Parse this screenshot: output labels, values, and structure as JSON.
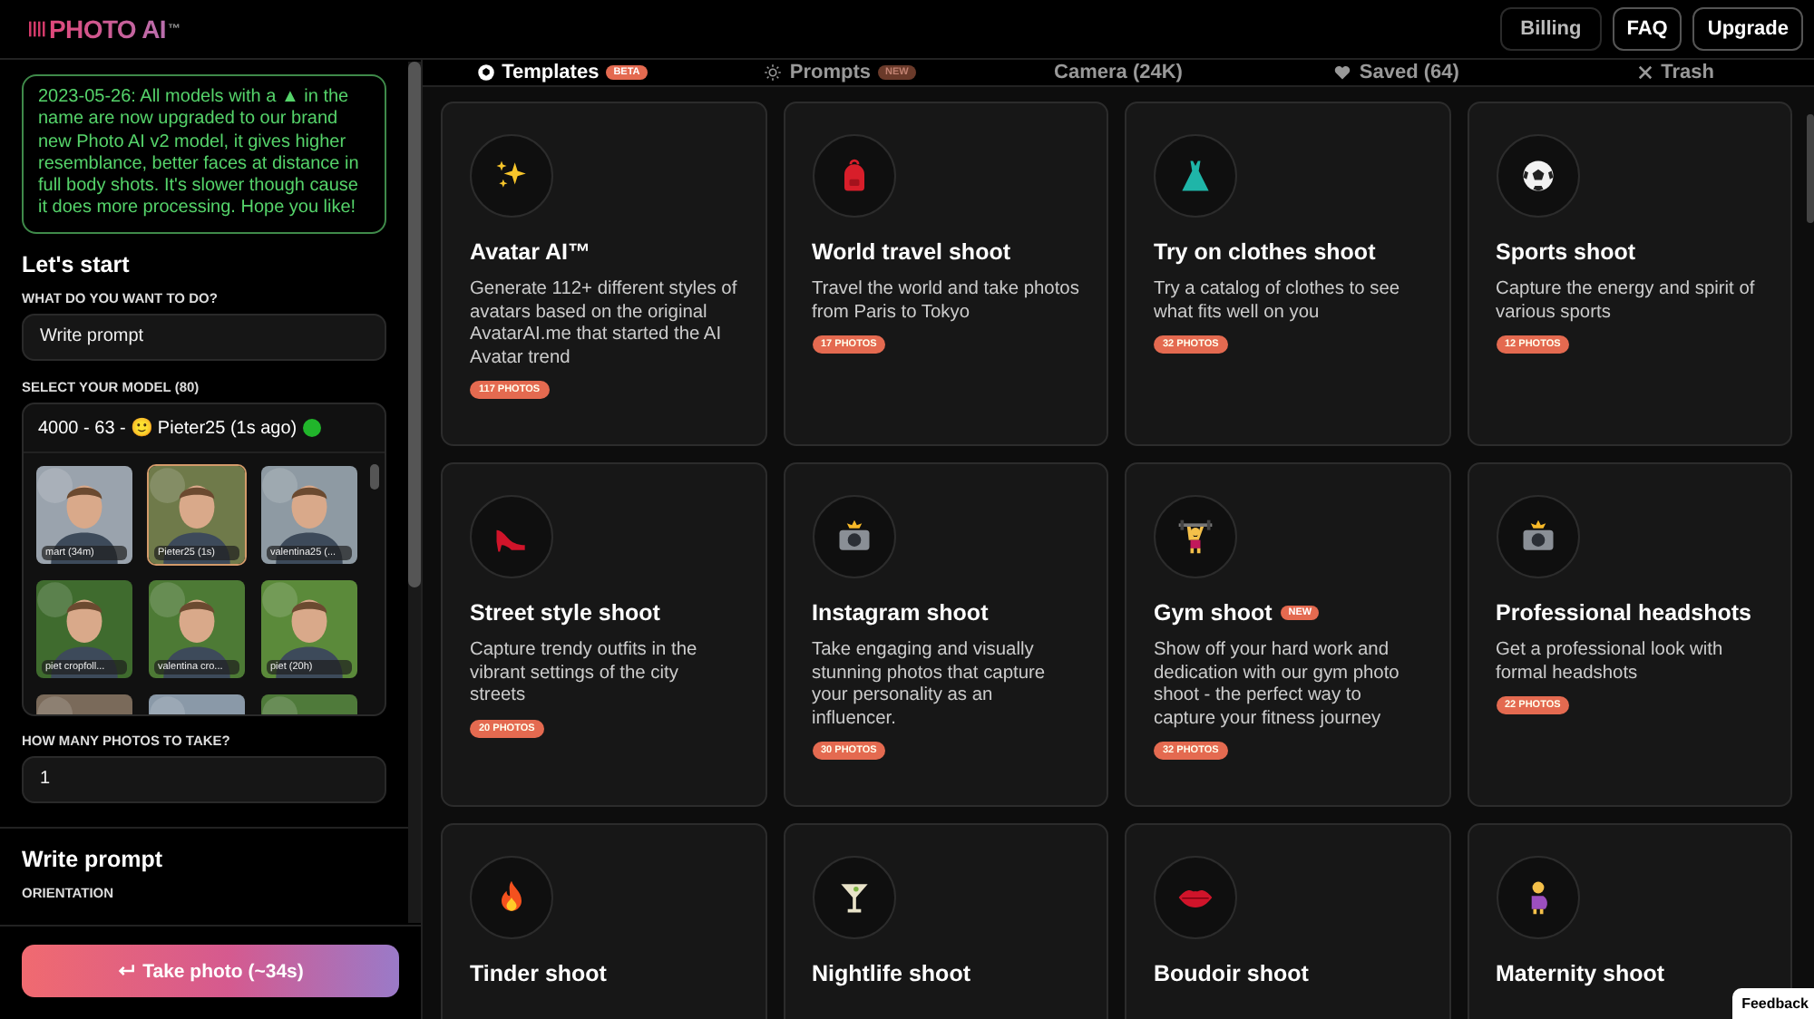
{
  "header": {
    "logo": "PHOTO AI",
    "logo_mark": "™",
    "buttons": [
      {
        "label": "Billing",
        "kind": "plain"
      },
      {
        "label": "FAQ",
        "kind": "outlined"
      },
      {
        "label": "Upgrade",
        "kind": "outlined"
      }
    ]
  },
  "sidebar": {
    "notice": "2023-05-26: All models with a ▲ in the name are now upgraded to our brand new Photo AI v2 model, it gives higher resemblance, better faces at distance in full body shots. It's slower though cause it does more processing. Hope you like!",
    "heading": "Let's start",
    "task": {
      "label": "WHAT DO YOU WANT TO DO?",
      "value": "Write prompt"
    },
    "model": {
      "label": "SELECT YOUR MODEL (80)",
      "value": "4000 - 63 - 🙂 Pieter25 (1s ago)",
      "online": true,
      "models": [
        {
          "caption": "mart (34m)",
          "selected": false
        },
        {
          "caption": "Pieter25 (1s)",
          "selected": true
        },
        {
          "caption": "valentina25 (...",
          "selected": false
        },
        {
          "caption": "piet cropfoll...",
          "selected": false
        },
        {
          "caption": "valentina cro...",
          "selected": false
        },
        {
          "caption": "piet (20h)",
          "selected": false
        },
        {
          "selected": false
        },
        {
          "selected": false
        },
        {
          "selected": false
        }
      ]
    },
    "count": {
      "label": "HOW MANY PHOTOS TO TAKE?",
      "value": "1"
    },
    "section": "Write prompt",
    "orientation_label": "ORIENTATION",
    "action": "Take photo (~34s)"
  },
  "tabs": [
    {
      "label": "Templates",
      "badge": "BETA",
      "selected": true
    },
    {
      "label": "Prompts",
      "badge": "NEW",
      "selected": false
    },
    {
      "label": "Camera (24K)",
      "selected": false
    },
    {
      "label": "Saved (64)",
      "selected": false
    },
    {
      "label": "Trash",
      "selected": false
    }
  ],
  "templates": [
    {
      "title": "Avatar AI™",
      "description": "Generate 112+ different styles of avatars based on the original AvatarAI.me that started the AI Avatar trend",
      "photos": "117 PHOTOS"
    },
    {
      "title": "World travel shoot",
      "description": "Travel the world and take photos from Paris to Tokyo",
      "photos": "17 PHOTOS"
    },
    {
      "title": "Try on clothes shoot",
      "description": "Try a catalog of clothes to see what fits well on you",
      "photos": "32 PHOTOS"
    },
    {
      "title": "Sports shoot",
      "description": "Capture the energy and spirit of various sports",
      "photos": "12 PHOTOS"
    },
    {
      "title": "Street style shoot",
      "description": "Capture trendy outfits in the vibrant settings of the city streets",
      "photos": "20 PHOTOS"
    },
    {
      "title": "Instagram shoot",
      "description": "Take engaging and visually stunning photos that capture your personality as an influencer.",
      "photos": "30 PHOTOS"
    },
    {
      "title": "Gym shoot",
      "badge": "NEW",
      "description": "Show off your hard work and dedication with our gym photo shoot - the perfect way to capture your fitness journey",
      "photos": "32 PHOTOS"
    },
    {
      "title": "Professional headshots",
      "description": "Get a professional look with formal headshots",
      "photos": "22 PHOTOS"
    },
    {
      "title": "Tinder shoot"
    },
    {
      "title": "Nightlife shoot"
    },
    {
      "title": "Boudoir shoot"
    },
    {
      "title": "Maternity shoot"
    }
  ],
  "feedback": "Feedback"
}
